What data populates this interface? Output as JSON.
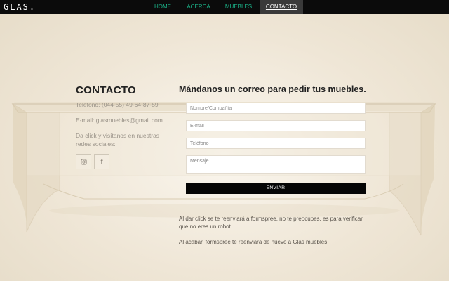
{
  "brand": {
    "logo": "GLAS."
  },
  "nav": [
    {
      "label": "HOME"
    },
    {
      "label": "ACERCA"
    },
    {
      "label": "MUEBLES"
    },
    {
      "label": "CONTACTO"
    }
  ],
  "contact": {
    "title": "CONTACTO",
    "phone": "Teléfono: (044-55) 49-64-87-59",
    "email": "E-mail: glasmuebles@gmail.com",
    "social_text": "Da click y visítanos en nuestras redes sociales:",
    "social_icons": [
      "instagram-icon",
      "facebook-icon"
    ]
  },
  "form": {
    "title": "Mándanos un correo para pedir tus muebles.",
    "name_placeholder": "Nombre/Compañía",
    "email_placeholder": "E-mail",
    "phone_placeholder": "Teléfono",
    "message_placeholder": "Mensaje",
    "send_label": "ENVIAR",
    "note1": "Al dar click se te reenviará a formspree, no te preocupes, es para verificar que no eres un robot.",
    "note2": "Al acabar, formspree te reenviará de nuevo a Glas muebles."
  },
  "colors": {
    "nav_accent": "#1bb58a",
    "topbar": "#0b0b0b",
    "button": "#050505"
  }
}
